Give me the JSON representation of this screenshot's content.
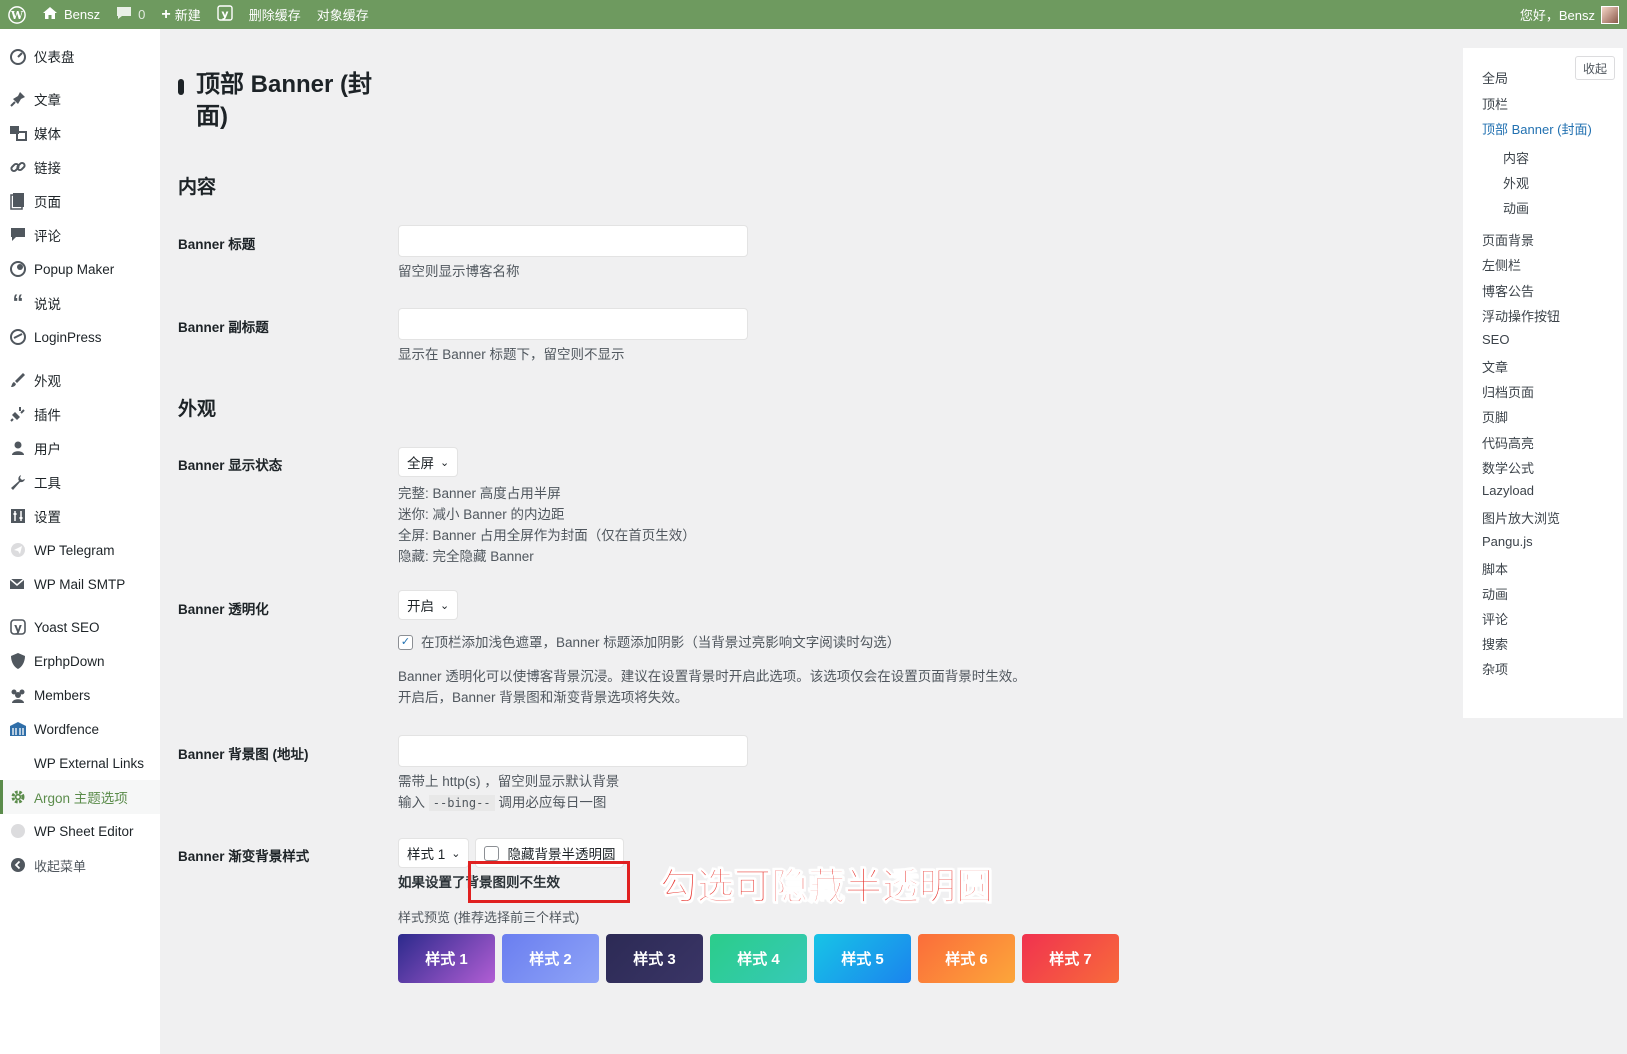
{
  "adminbar": {
    "site_name": "Bensz",
    "comments_count": "0",
    "new_label": "新建",
    "clear_cache_label": "删除缓存",
    "object_cache_label": "对象缓存",
    "greeting": "您好，Bensz"
  },
  "menu": {
    "dashboard": "仪表盘",
    "posts": "文章",
    "media": "媒体",
    "links": "链接",
    "pages": "页面",
    "comments": "评论",
    "popup_maker": "Popup Maker",
    "shuoshuo": "说说",
    "loginpress": "LoginPress",
    "appearance": "外观",
    "plugins": "插件",
    "users": "用户",
    "tools": "工具",
    "settings": "设置",
    "wp_telegram": "WP Telegram",
    "wp_mail_smtp": "WP Mail SMTP",
    "yoast_seo": "Yoast SEO",
    "erphpdown": "ErphpDown",
    "members": "Members",
    "wordfence": "Wordfence",
    "wp_external_links": "WP External Links",
    "argon_options": "Argon 主题选项",
    "wp_sheet_editor": "WP Sheet Editor",
    "collapse_menu": "收起菜单"
  },
  "main": {
    "page_title": "顶部 Banner (封面)",
    "section_content": "内容",
    "section_appearance": "外观",
    "banner_title": {
      "label": "Banner 标题",
      "value": "",
      "desc": "留空则显示博客名称"
    },
    "banner_subtitle": {
      "label": "Banner 副标题",
      "value": "",
      "desc": "显示在 Banner 标题下，留空则不显示"
    },
    "banner_display": {
      "label": "Banner 显示状态",
      "selected": "全屏",
      "desc_lines": [
        "完整: Banner 高度占用半屏",
        "迷你: 减小 Banner 的内边距",
        "全屏: Banner 占用全屏作为封面（仅在首页生效）",
        "隐藏: 完全隐藏 Banner"
      ]
    },
    "banner_transparent": {
      "label": "Banner 透明化",
      "selected": "开启",
      "checkbox_label": "在顶栏添加浅色遮罩，Banner 标题添加阴影（当背景过亮影响文字阅读时勾选）",
      "checkbox_checked": true,
      "desc_lines": [
        "Banner 透明化可以使博客背景沉浸。建议在设置背景时开启此选项。该选项仅会在设置页面背景时生效。",
        "开启后，Banner 背景图和渐变背景选项将失效。"
      ]
    },
    "banner_bg_image": {
      "label": "Banner 背景图 (地址)",
      "value": "",
      "desc_line1": "需带上 http(s) ，留空则显示默认背景",
      "desc_line2_prefix": "输入",
      "desc_code": "--bing--",
      "desc_line2_suffix": "调用必应每日一图"
    },
    "banner_gradient": {
      "label": "Banner 渐变背景样式",
      "selected": "样式 1",
      "hide_circle_label": "隐藏背景半透明圆",
      "hide_circle_checked": false,
      "note": "如果设置了背景图则不生效",
      "preview_label": "样式预览 (推荐选择前三个样式)",
      "styles": [
        {
          "label": "样式 1",
          "from": "#2c2a8c",
          "to": "#b15ed4"
        },
        {
          "label": "样式 2",
          "from": "#6a7ef0",
          "to": "#8fa4f7"
        },
        {
          "label": "样式 3",
          "from": "#2c2a55",
          "to": "#3a3566"
        },
        {
          "label": "样式 4",
          "from": "#2bcd8a",
          "to": "#36c9b8"
        },
        {
          "label": "样式 5",
          "from": "#17c4e6",
          "to": "#1b84ee"
        },
        {
          "label": "样式 6",
          "from": "#fb6d3a",
          "to": "#fca63a"
        },
        {
          "label": "样式 7",
          "from": "#f0324f",
          "to": "#f86b3b"
        }
      ]
    },
    "annotation": "勾选可隐藏半透明圆"
  },
  "toc": {
    "collapse_label": "收起",
    "items": [
      {
        "label": "全局"
      },
      {
        "label": "顶栏"
      },
      {
        "label": "顶部 Banner (封面)"
      },
      {
        "label": "内容"
      },
      {
        "label": "外观"
      },
      {
        "label": "动画"
      },
      {
        "label": "页面背景"
      },
      {
        "label": "左侧栏"
      },
      {
        "label": "博客公告"
      },
      {
        "label": "浮动操作按钮"
      },
      {
        "label": "SEO"
      },
      {
        "label": "文章"
      },
      {
        "label": "归档页面"
      },
      {
        "label": "页脚"
      },
      {
        "label": "代码高亮"
      },
      {
        "label": "数学公式"
      },
      {
        "label": "Lazyload"
      },
      {
        "label": "图片放大浏览"
      },
      {
        "label": "Pangu.js"
      },
      {
        "label": "脚本"
      },
      {
        "label": "动画"
      },
      {
        "label": "评论"
      },
      {
        "label": "搜索"
      },
      {
        "label": "杂项"
      }
    ]
  },
  "colors": {
    "adminbar": "#6e9a5f",
    "accent": "#5b8c4b",
    "link": "#2271b1",
    "annotation": "#e8302a"
  }
}
